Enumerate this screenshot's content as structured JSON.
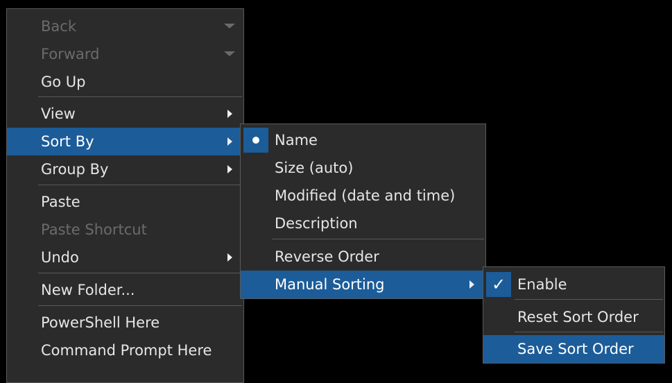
{
  "main_menu": {
    "back": "Back",
    "forward": "Forward",
    "go_up": "Go Up",
    "view": "View",
    "sort_by": "Sort By",
    "group_by": "Group By",
    "paste": "Paste",
    "paste_shortcut": "Paste Shortcut",
    "undo": "Undo",
    "new_folder": "New Folder...",
    "powershell_here": "PowerShell Here",
    "command_prompt_here": "Command Prompt Here"
  },
  "sort_menu": {
    "name": "Name",
    "size": "Size (auto)",
    "modified": "Modified (date and time)",
    "description": "Description",
    "reverse_order": "Reverse Order",
    "manual_sorting": "Manual Sorting",
    "selected_item": "Name"
  },
  "manual_menu": {
    "enable": "Enable",
    "enable_checked": true,
    "reset_sort_order": "Reset Sort Order",
    "save_sort_order": "Save Sort Order"
  },
  "icons": {
    "radio": "radio-dot-icon",
    "check": "checkmark-icon",
    "submenu": "chevron-right-icon",
    "history": "chevron-down-icon"
  },
  "colors": {
    "menu_bg": "#2b2b2b",
    "highlight": "#1c5c99",
    "text": "#e6e6e6",
    "disabled": "#6b6b6b",
    "separator": "#5a5a5a"
  }
}
